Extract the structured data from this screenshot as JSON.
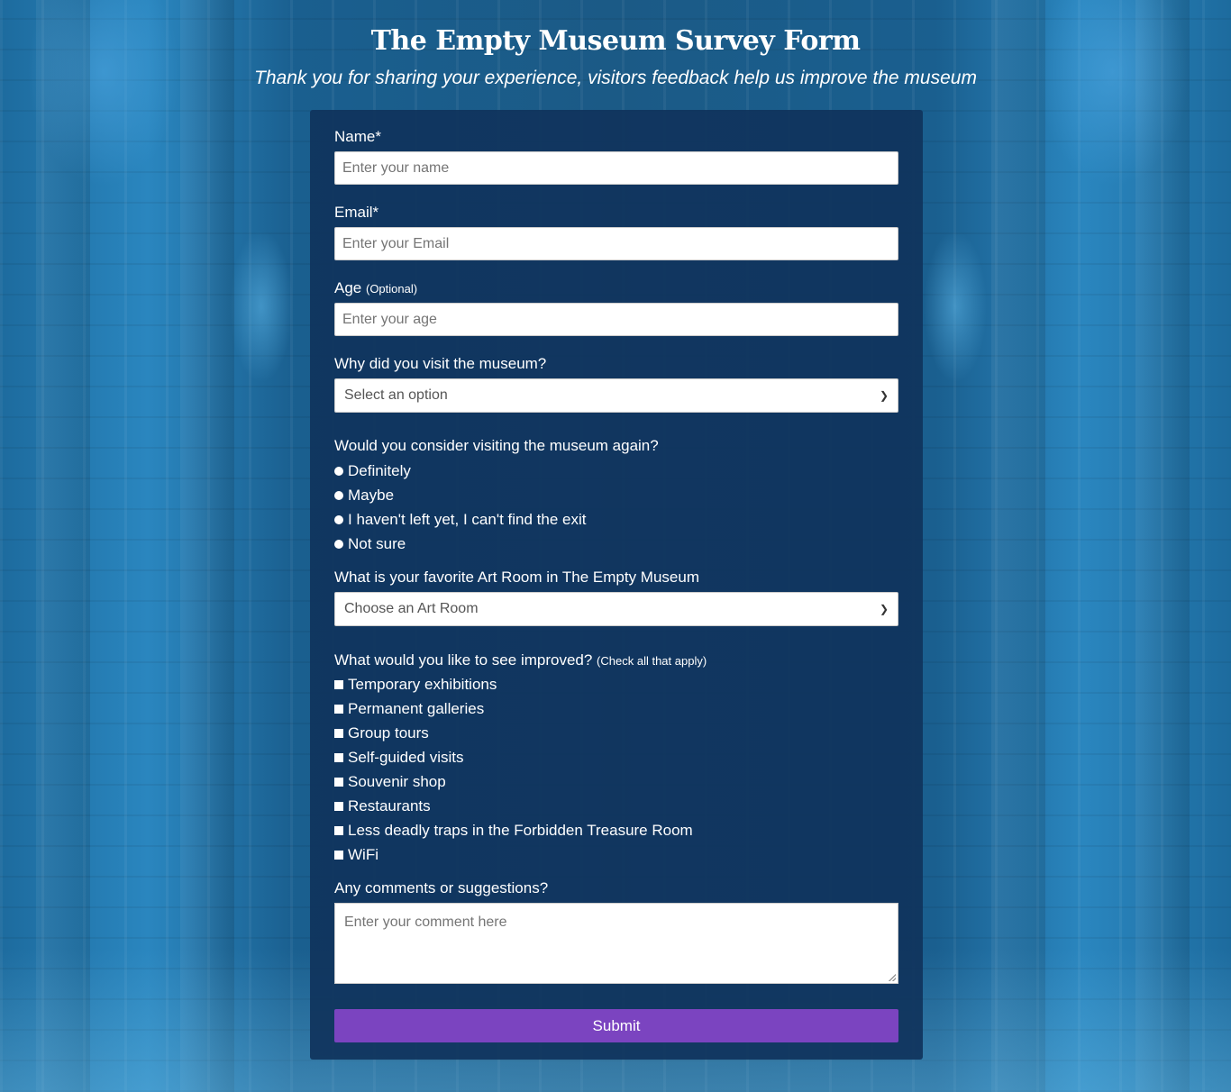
{
  "header": {
    "title": "The Empty Museum Survey Form",
    "subtitle": "Thank you for sharing your experience, visitors feedback help us improve the museum"
  },
  "form": {
    "name": {
      "label": "Name*",
      "placeholder": "Enter your name"
    },
    "email": {
      "label": "Email*",
      "placeholder": "Enter your Email"
    },
    "age": {
      "label": "Age",
      "label_note": "(Optional)",
      "placeholder": "Enter your age"
    },
    "reason": {
      "label": "Why did you visit the museum?",
      "selected": "Select an option"
    },
    "revisit": {
      "label": "Would you consider visiting the museum again?",
      "options": [
        "Definitely",
        "Maybe",
        "I haven't left yet, I can't find the exit",
        "Not sure"
      ]
    },
    "art_room": {
      "label": "What is your favorite Art Room in The Empty Museum",
      "selected": "Choose an Art Room"
    },
    "improve": {
      "label": "What would you like to see improved?",
      "label_note": "(Check all that apply)",
      "options": [
        "Temporary exhibitions",
        "Permanent galleries",
        "Group tours",
        "Self-guided visits",
        "Souvenir shop",
        "Restaurants",
        "Less deadly traps in the Forbidden Treasure Room",
        "WiFi"
      ]
    },
    "comments": {
      "label": "Any comments or suggestions?",
      "placeholder": "Enter your comment here"
    },
    "submit_label": "Submit"
  },
  "colors": {
    "card_bg": "#10345c",
    "submit": "#7b44c0",
    "background": "#1b5a86"
  }
}
